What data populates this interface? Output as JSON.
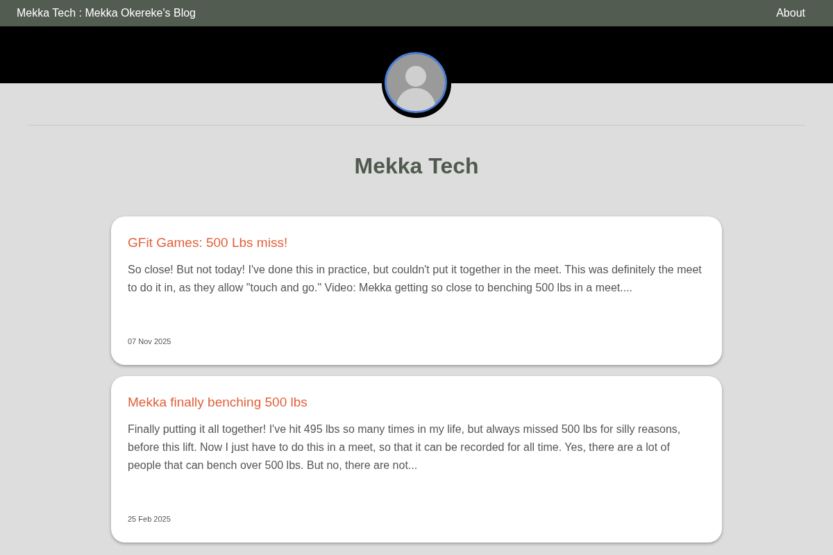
{
  "nav": {
    "site_title": "Mekka Tech : Mekka Okereke's Blog",
    "links": [
      {
        "label": "About"
      }
    ]
  },
  "heading": "Mekka Tech",
  "posts": [
    {
      "title": "GFit Games: 500 Lbs miss!",
      "excerpt": "So close! But not today! I've done this in practice, but couldn't put it together in the meet. This was definitely the meet to do it in, as they allow \"touch and go.\" Video: Mekka getting so close to benching 500 lbs in a meet....",
      "date": "07 Nov 2025"
    },
    {
      "title": "Mekka finally benching 500 lbs",
      "excerpt": "Finally putting it all together! I've hit 495 lbs so many times in my life, but always missed 500 lbs for silly reasons, before this lift. Now I just have to do this in a meet, so that it can be recorded for all time. Yes, there are a lot of people that can bench over 500 lbs. But no, there are not...",
      "date": "25 Feb 2025"
    }
  ]
}
